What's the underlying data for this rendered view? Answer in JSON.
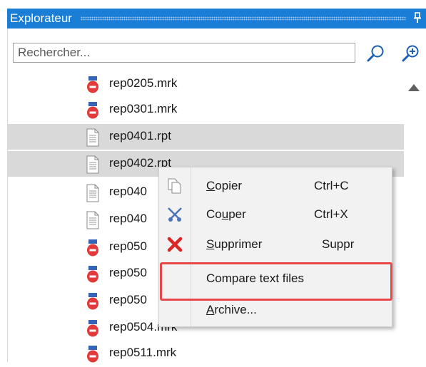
{
  "panel": {
    "title": "Explorateur",
    "pin_glyph": "↕"
  },
  "search": {
    "placeholder": "Rechercher...",
    "search_icon": "search-icon",
    "add_icon": "zoom-in-icon"
  },
  "files": [
    {
      "name": "rep0205.mrk",
      "type": "mrk",
      "selected": false
    },
    {
      "name": "rep0301.mrk",
      "type": "mrk",
      "selected": false
    },
    {
      "name": "rep0401.rpt",
      "type": "rpt",
      "selected": true
    },
    {
      "name": "rep0402.rpt",
      "type": "rpt",
      "selected": true
    },
    {
      "name": "rep040",
      "type": "rpt",
      "selected": false
    },
    {
      "name": "rep040",
      "type": "rpt",
      "selected": false
    },
    {
      "name": "rep050",
      "type": "mrk",
      "selected": false
    },
    {
      "name": "rep050",
      "type": "mrk",
      "selected": false
    },
    {
      "name": "rep050",
      "type": "mrk",
      "selected": false
    },
    {
      "name": "rep0504.mrk",
      "type": "mrk",
      "selected": false
    },
    {
      "name": "rep0511.mrk",
      "type": "mrk",
      "selected": false
    }
  ],
  "context_menu": {
    "items": [
      {
        "label": "Copier",
        "accel": "C",
        "shortcut": "Ctrl+C",
        "icon": "copy-icon"
      },
      {
        "label": "Couper",
        "accel": "u",
        "shortcut": "Ctrl+X",
        "icon": "scissors-icon"
      },
      {
        "label": "Supprimer",
        "accel": "S",
        "shortcut": "Suppr",
        "icon": "delete-icon"
      },
      {
        "label": "Compare text files",
        "accel": "",
        "shortcut": "",
        "icon": ""
      },
      {
        "label": "Archive...",
        "accel": "A",
        "shortcut": "",
        "icon": ""
      }
    ],
    "highlighted_item": "Compare text files",
    "highlight_color": "#e8474a"
  },
  "colors": {
    "titlebar": "#1b7ed6",
    "selection": "#d9d9d9",
    "menu_bg": "#f2f2f2"
  }
}
